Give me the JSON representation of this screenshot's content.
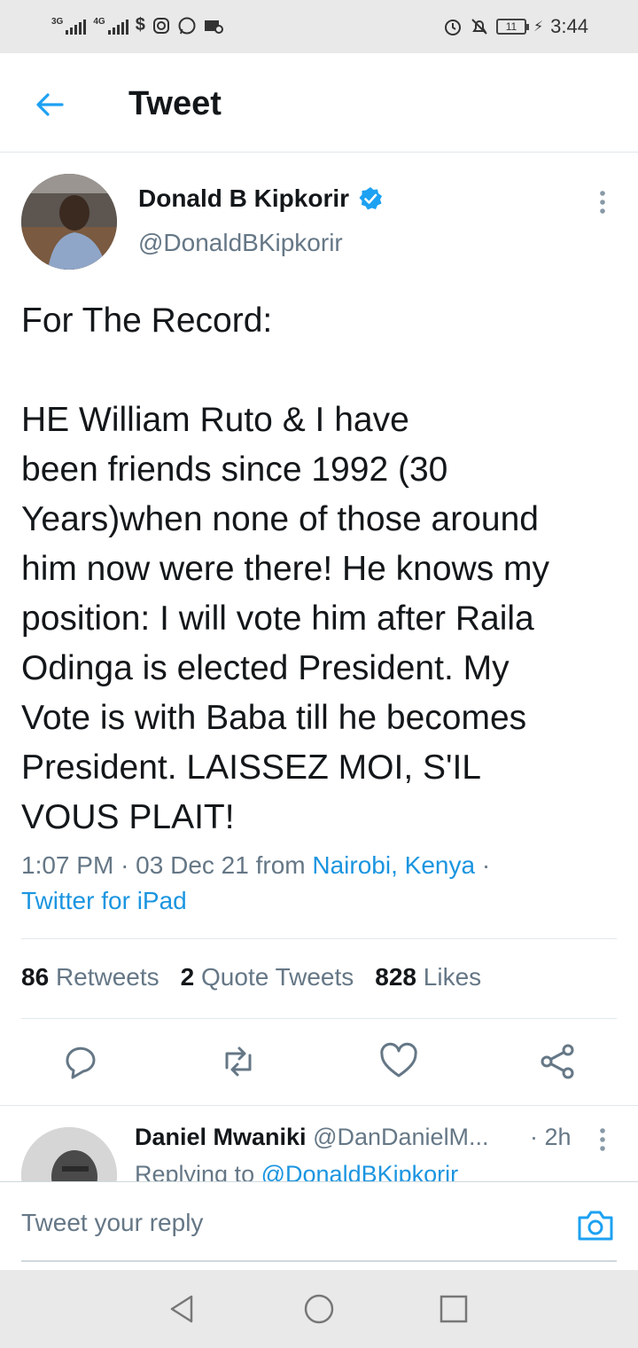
{
  "status_bar": {
    "signal1": "3G",
    "signal2": "4G",
    "battery": "11",
    "time": "3:44"
  },
  "header": {
    "title": "Tweet"
  },
  "tweet": {
    "author_name": "Donald B Kipkorir",
    "author_handle": "@DonaldBKipkorir",
    "text": "For The Record:\n\nHE William Ruto & I have\nbeen friends since 1992 (30\nYears)when none of those around\nhim now were there! He knows my\nposition: I will vote him after Raila\nOdinga is elected President. My\nVote is with Baba till he becomes\nPresident. LAISSEZ MOI, S'IL\nVOUS PLAIT!",
    "time": "1:07 PM",
    "date": "03 Dec 21",
    "from_label": "from",
    "location": "Nairobi, Kenya",
    "client": "Twitter for iPad"
  },
  "stats": {
    "retweets_count": "86",
    "retweets_label": "Retweets",
    "quotes_count": "2",
    "quotes_label": "Quote Tweets",
    "likes_count": "828",
    "likes_label": "Likes"
  },
  "reply": {
    "name": "Daniel Mwaniki",
    "handle": "@DanDanielM...",
    "time": "· 2h",
    "replying_prefix": "Replying to",
    "replying_to": "@DonaldBKipkorir"
  },
  "composer": {
    "placeholder": "Tweet your reply"
  },
  "colors": {
    "accent": "#1da1f2",
    "link": "#1b95e0",
    "secondary_text": "#657786"
  }
}
